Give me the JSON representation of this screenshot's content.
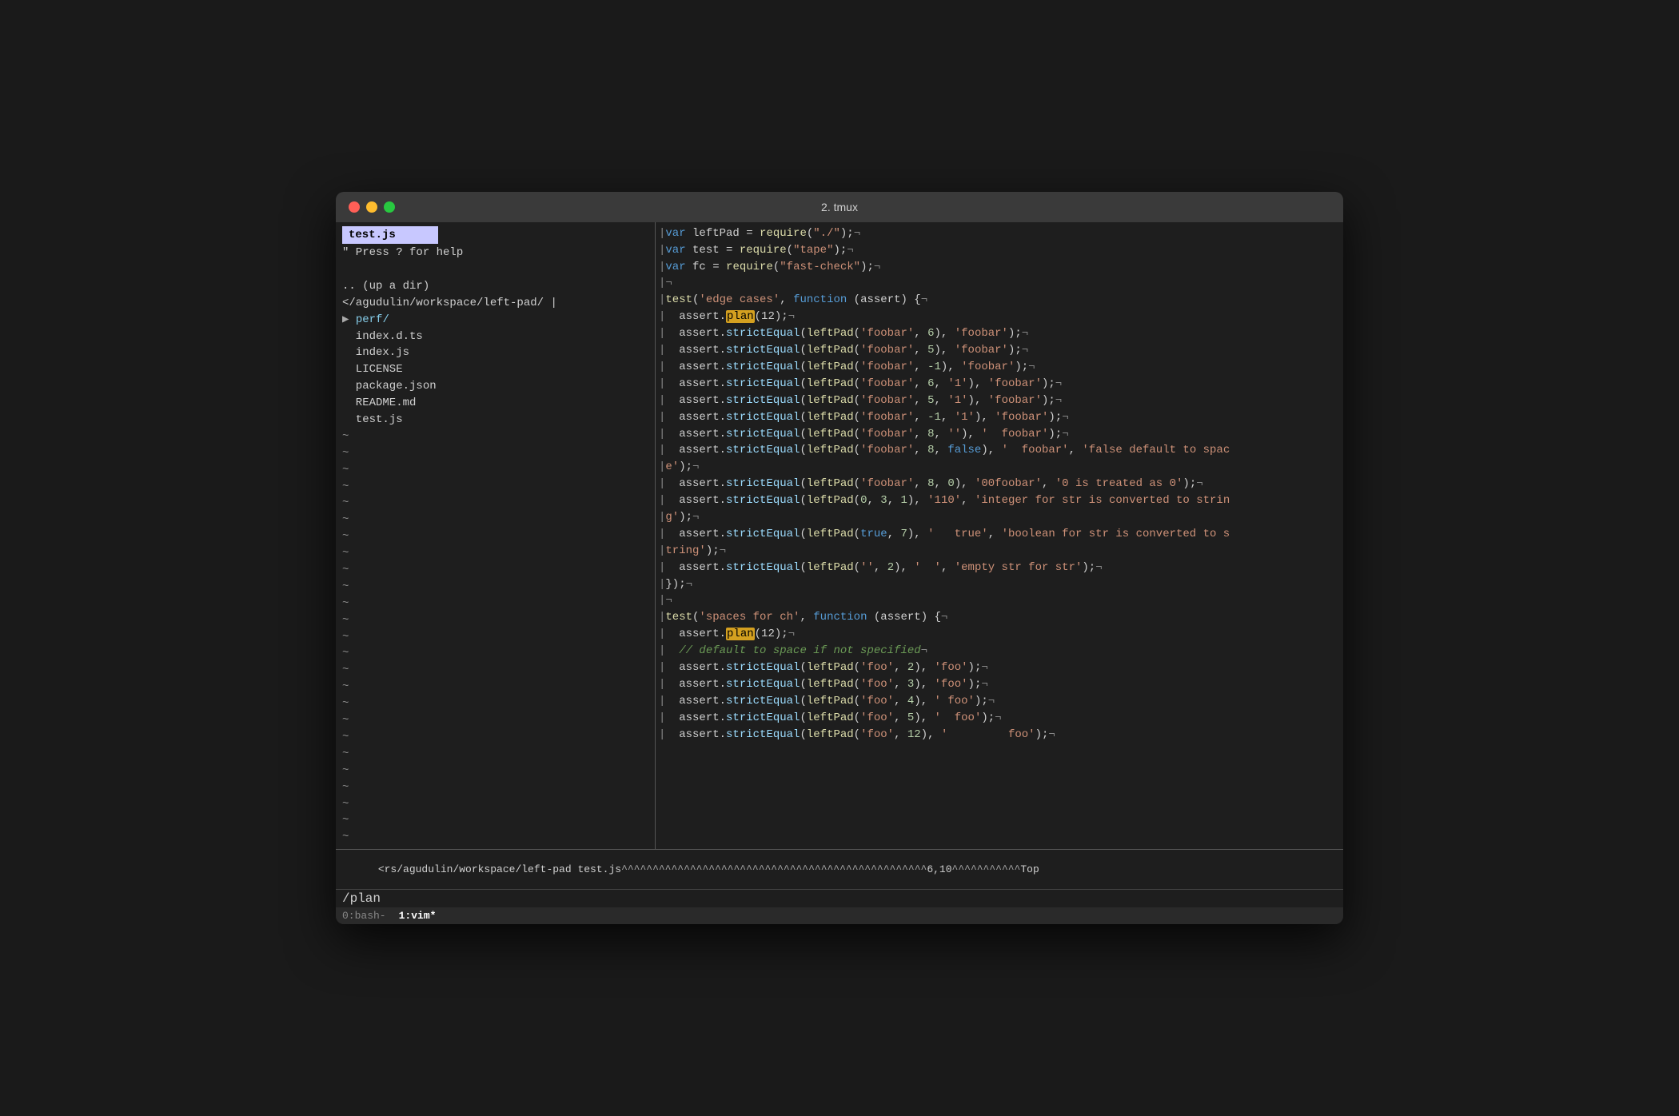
{
  "window": {
    "title": "2. tmux",
    "traffic_lights": [
      "red",
      "yellow",
      "green"
    ]
  },
  "left_pane": {
    "header": "test.js",
    "help_line": "\" Press ? for help",
    "lines": [
      "",
      ".. (up a dir)",
      "</agudulin/workspace/left-pad/",
      "  perf/",
      "  index.d.ts",
      "  index.js",
      "  LICENSE",
      "  package.json",
      "  README.md",
      "  test.js",
      "~",
      "~",
      "~",
      "~",
      "~",
      "~",
      "~",
      "~",
      "~",
      "~",
      "~",
      "~",
      "~",
      "~",
      "~",
      "~",
      "~",
      "~",
      "~",
      "~",
      "~",
      "~",
      "~",
      "~",
      "~",
      "~"
    ]
  },
  "right_pane": {
    "lines": [
      "|var leftPad = require(\"./\");¬",
      "|var test = require(\"tape\");¬",
      "|var fc = require(\"fast-check\");¬",
      "|¬",
      "|test('edge cases', function (assert) {¬",
      "|  assert.plan(12);¬",
      "|  assert.strictEqual(leftPad('foobar', 6), 'foobar');¬",
      "|  assert.strictEqual(leftPad('foobar', 5), 'foobar');¬",
      "|  assert.strictEqual(leftPad('foobar', -1), 'foobar');¬",
      "|  assert.strictEqual(leftPad('foobar', 6, '1'), 'foobar');¬",
      "|  assert.strictEqual(leftPad('foobar', 5, '1'), 'foobar');¬",
      "|  assert.strictEqual(leftPad('foobar', -1, '1'), 'foobar');¬",
      "|  assert.strictEqual(leftPad('foobar', 8, ''), '  foobar');¬",
      "|  assert.strictEqual(leftPad('foobar', 8, false), '  foobar', 'false default to spac",
      "|e');¬",
      "|  assert.strictEqual(leftPad('foobar', 8, 0), '00foobar', '0 is treated as 0');¬",
      "|  assert.strictEqual(leftPad(0, 3, 1), '110', 'integer for str is converted to strin",
      "|g');¬",
      "|  assert.strictEqual(leftPad(true, 7), '   true', 'boolean for str is converted to s",
      "|tring');¬",
      "|  assert.strictEqual(leftPad('', 2), '  ', 'empty str for str');¬",
      "|});¬",
      "|¬",
      "|test('spaces for ch', function (assert) {¬",
      "|  assert.plan(12);¬",
      "|  // default to space if not specified¬",
      "|  assert.strictEqual(leftPad('foo', 2), 'foo');¬",
      "|  assert.strictEqual(leftPad('foo', 3), 'foo');¬",
      "|  assert.strictEqual(leftPad('foo', 4), ' foo');¬",
      "|  assert.strictEqual(leftPad('foo', 5), '  foo');¬",
      "|  assert.strictEqual(leftPad('foo', 12), '         foo');¬"
    ]
  },
  "status_bar": {
    "text": "<rs/agudulin/workspace/left-pad test.js^^^^^^^^^^^^^^^^^^^^^^^^^^^^^^^^^^^^^^^^^^^^^^^^^6,10^^^^^^^^^^^Top",
    "cmd_line": "/plan"
  },
  "bottom_tabs": {
    "tabs": [
      {
        "id": "0",
        "label": "0:bash-",
        "active": false
      },
      {
        "id": "1",
        "label": "1:vim*",
        "active": true
      }
    ]
  }
}
